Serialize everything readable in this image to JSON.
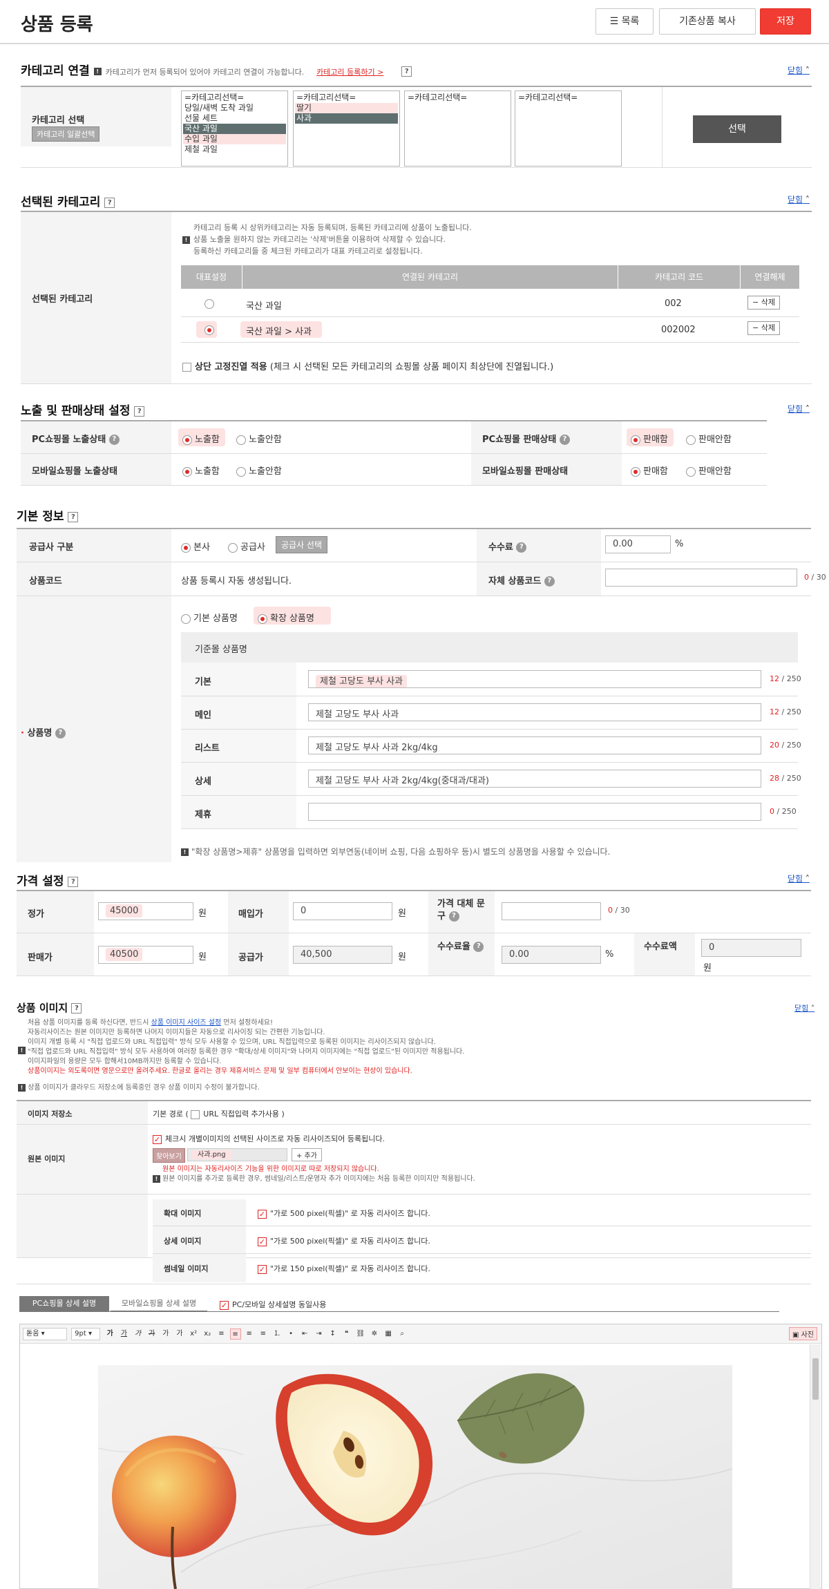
{
  "header": {
    "title": "상품 등록",
    "list_btn": "목록",
    "copy_btn": "기존상품 복사",
    "save_btn": "저장"
  },
  "fold": "닫힘",
  "category": {
    "title": "카테고리 연결",
    "desc": "카테고리가 먼저 등록되어 있어야 카테고리 연결이 가능합니다.",
    "register_link": "카테고리 등록하기 >",
    "label": "카테고리 선택",
    "bulk_btn": "카테고리 일괄선택",
    "select_btn": "선택",
    "list1": [
      "=카테고리선택=",
      "당일/새벽 도착 과일",
      "선물 세트",
      "국산 과일",
      "수입 과일",
      "제철 과일"
    ],
    "list2": [
      "=카테고리선택=",
      "딸기",
      "사과"
    ],
    "list3": [
      "=카테고리선택="
    ],
    "list4": [
      "=카테고리선택="
    ]
  },
  "selected": {
    "title": "선택된 카테고리",
    "label": "선택된 카테고리",
    "notes": [
      "카테고리 등록 시 상위카테고리는 자동 등록되며, 등록된 카테고리에 상품이 노출됩니다.",
      "상품 노출을 원하지 않는 카테고리는 '삭제'버튼을 이용하여 삭제할 수 있습니다.",
      "등록하신 카테고리들 중 체크된 카테고리가 대표 카테고리로 설정됩니다."
    ],
    "cols": [
      "대표설정",
      "연결된 카테고리",
      "카테고리 코드",
      "연결해제"
    ],
    "rows": [
      {
        "name": "국산 과일",
        "code": "002",
        "del": "삭제"
      },
      {
        "name": "국산 과일 > 사과",
        "code": "002002",
        "del": "삭제"
      }
    ],
    "fix_label": "상단 고정진열 적용",
    "fix_desc": "(체크 시 선택된 모든 카테고리의 쇼핑몰 상품 페이지 최상단에 진열됩니다.)"
  },
  "display": {
    "title": "노출 및 판매상태 설정",
    "pc_show": "PC쇼핑몰 노출상태",
    "pc_sale": "PC쇼핑몰 판매상태",
    "mo_show": "모바일쇼핑몰 노출상태",
    "mo_sale": "모바일쇼핑몰 판매상태",
    "show_on": "노출함",
    "show_off": "노출안함",
    "sale_on": "판매함",
    "sale_off": "판매안함"
  },
  "basic": {
    "title": "기본 정보",
    "supplier_label": "공급사 구분",
    "supplier_main": "본사",
    "supplier_other": "공급사",
    "supplier_btn": "공급사 선택",
    "fee_label": "수수료",
    "fee_value": "0.00",
    "fee_unit": "%",
    "code_label": "상품코드",
    "code_value": "상품 등록시 자동 생성됩니다.",
    "own_code_label": "자체 상품코드",
    "own_code_count": "0",
    "own_code_max": "/ 30",
    "name_label": "상품명",
    "name_basic": "기본 상품명",
    "name_ext": "확장 상품명",
    "name_ref": "기준몰 상품명",
    "names": [
      {
        "label": "기본",
        "value": "제철 고당도 부사 사과",
        "count": "12",
        "max": "/ 250"
      },
      {
        "label": "메인",
        "value": "제철 고당도 부사 사과",
        "count": "12",
        "max": "/ 250"
      },
      {
        "label": "리스트",
        "value": "제철 고당도 부사 사과 2kg/4kg",
        "count": "20",
        "max": "/ 250"
      },
      {
        "label": "상세",
        "value": "제철 고당도 부사 사과 2kg/4kg(중대과/대과)",
        "count": "28",
        "max": "/ 250"
      },
      {
        "label": "제휴",
        "value": "",
        "count": "0",
        "max": "/ 250"
      }
    ],
    "name_note": "\"확장 상품명>제휴\" 상품명을 입력하면 외부연동(네이버 쇼핑, 다음 쇼핑하우 등)시 별도의 상품명을 사용할 수 있습니다."
  },
  "price": {
    "title": "가격 설정",
    "list_label": "정가",
    "list_value": "45000",
    "buy_label": "매입가",
    "buy_value": "0",
    "alt_label": "가격 대체 문구",
    "alt_count": "0",
    "alt_max": "/ 30",
    "sale_label": "판매가",
    "sale_value": "40500",
    "supply_label": "공급가",
    "supply_value": "40,500",
    "rate_label": "수수료율",
    "rate_value": "0.00",
    "rate_unit": "%",
    "fee_amt_label": "수수료액",
    "fee_amt_value": "0",
    "won": "원"
  },
  "image": {
    "title": "상품 이미지",
    "notes": [
      {
        "t": "처음 상품 이미지를 등록 하신다면, 반드시 ",
        "link": "상품 이미지 사이즈 설정",
        "t2": " 먼저 설정하세요!"
      },
      {
        "t": "자동리사이즈는 원본 이미지만 등록하면 나머지 이미지들은 자동으로 리사이징 되는 간편한 기능입니다."
      },
      {
        "t": "이미지 개별 등록 시 \"직접 업로드와 URL 직접입력\" 방식 모두 사용할 수 있으며, URL 직접입력으로 등록된 이미지는 리사이즈되지 않습니다."
      },
      {
        "t": "\"직접 업로드와 URL 직접입력\" 방식 모두 사용하여 여러장 등록한 경우 \"확대/상세 이미지\"와 나머지 이미지에는 \"직접 업로드\"된 이미지만 적용됩니다."
      },
      {
        "t": "이미지파일의 용량은 모두 합해서10MB까지만 등록할 수 있습니다."
      }
    ],
    "warn1": "상품이미지는 외도록이면 영문으로만 올려주세요. 한글로 올리는 경우 제휴서비스 문제 및 일부 컴퓨터에서 안보이는 현상이 있습니다.",
    "warn2": "상품 이미지가 클라우드 저장소에 등록중인 경우 상품 이미지 수정이 불가합니다.",
    "storage_label": "이미지 저장소",
    "storage_value": "기본 경로 (",
    "url_label": "URL 직접입력 추가사용 )",
    "orig_label": "원본 이미지",
    "auto_resize": "체크시 개별이미지의 선택된 사이즈로 자동 리사이즈되어 등록됩니다.",
    "find_btn": "찾아보기",
    "file_name": "사과.png",
    "add_btn": "+ 추가",
    "orig_note1": "원본 이미지는 자동리사이즈 기능을 위한 이미지로 따로 저장되지 않습니다.",
    "orig_note2": "원본 이미지를 추가로 등록한 경우, 썸네일/리스트/운영자 추가 이미지에는 처음 등록한 이미지만 적용됩니다.",
    "sizes": [
      {
        "label": "확대 이미지",
        "text": "\"가로 500 pixel(픽셀)\" 로 자동 리사이즈 합니다."
      },
      {
        "label": "상세 이미지",
        "text": "\"가로 500 pixel(픽셀)\" 로 자동 리사이즈 합니다."
      },
      {
        "label": "썸네일 이미지",
        "text": "\"가로 150 pixel(픽셀)\" 로 자동 리사이즈 합니다."
      }
    ]
  },
  "detail": {
    "tab_pc": "PC쇼핑몰 상세 설명",
    "tab_mobile": "모바일쇼핑몰 상세 설명",
    "same_use": "PC/모바일 상세설명 동일사용",
    "font": "돋움",
    "size": "9pt",
    "photo_btn": "사진"
  }
}
